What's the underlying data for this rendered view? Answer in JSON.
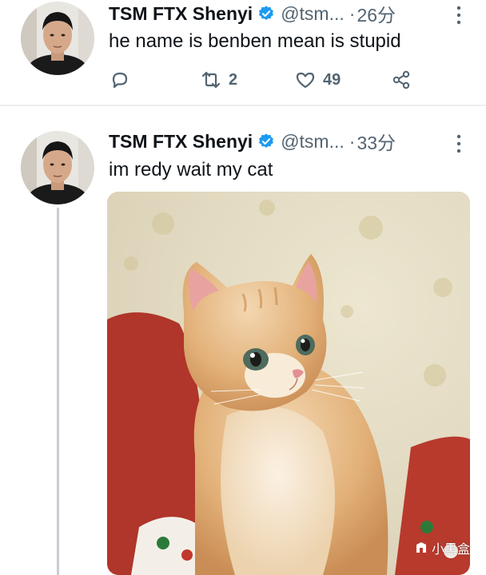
{
  "tweets": [
    {
      "name": "TSM FTX Shenyi",
      "handle": "@tsm...",
      "separator": "·",
      "time": "26分",
      "text": "he name is benben mean is stupid",
      "retweets": "2",
      "likes": "49"
    },
    {
      "name": "TSM FTX Shenyi",
      "handle": "@tsm...",
      "separator": "·",
      "time": "33分",
      "text": "im redy wait my cat",
      "media": "kitten-photo"
    }
  ],
  "watermark": "小黑盒",
  "colors": {
    "verified": "#1d9bf0",
    "secondary_text": "#536471",
    "thread_line": "#c7cdd2"
  }
}
